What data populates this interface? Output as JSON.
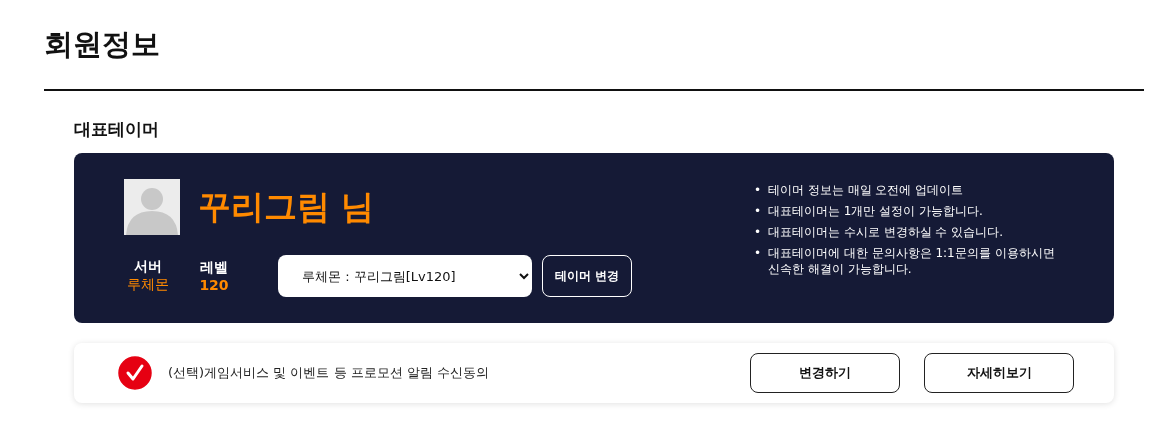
{
  "page_title": "회원정보",
  "section_title": "대표테이머",
  "profile": {
    "name": "꾸리그림 님",
    "server_label": "서버",
    "server": "루체몬",
    "level_label": "레벨",
    "level_value": "120",
    "tamer_select": "루체몬 : 꾸리그림[Lv120]",
    "change_button": "테이머 변경",
    "notes": [
      {
        "bullet": "•",
        "text": "테이머 정보는 매일 오전에 업데이트"
      },
      {
        "bullet": "•",
        "text": "대표테이머는 1개만 설정이 가능합니다."
      },
      {
        "bullet": "•",
        "text": "대표테이머는 수시로 변경하실 수 있습니다."
      },
      {
        "bullet": "•",
        "text": "대표테이머에 대한 문의사항은 1:1문의를 이용하시면 신속한 해결이 가능합니다."
      }
    ]
  },
  "consent": {
    "checked": true,
    "label": "(선택)게임서비스 및 이벤트 등 프로모션 알림 수신동의",
    "buttons": [
      "변경하기",
      "자세히보기"
    ]
  }
}
